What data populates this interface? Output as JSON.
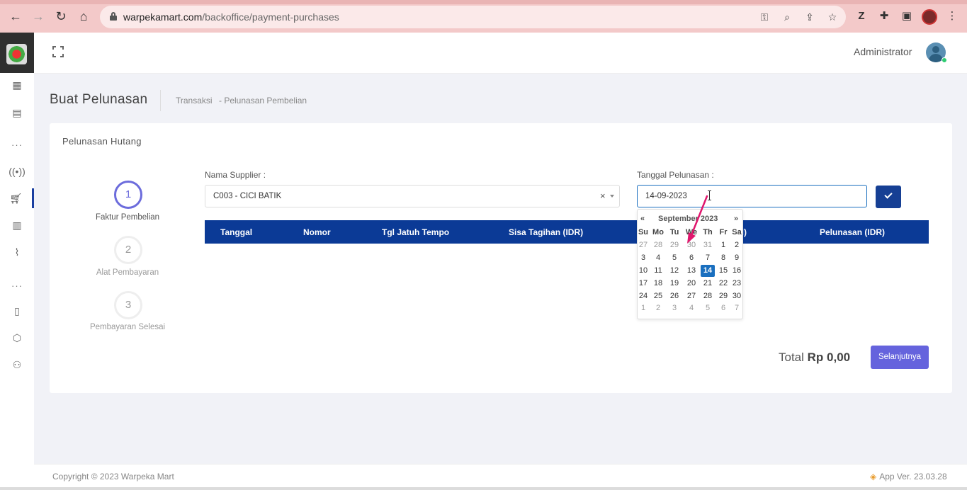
{
  "browser": {
    "url_host": "warpekamart.com",
    "url_path": "/backoffice/payment-purchases"
  },
  "header": {
    "user_name": "Administrator"
  },
  "page": {
    "title": "Buat Pelunasan",
    "breadcrumb": [
      "Transaksi",
      "- Pelunasan Pembelian"
    ]
  },
  "card": {
    "title": "Pelunasan Hutang",
    "steps": [
      {
        "number": "1",
        "label": "Faktur Pembelian",
        "active": true
      },
      {
        "number": "2",
        "label": "Alat Pembayaran",
        "active": false
      },
      {
        "number": "3",
        "label": "Pembayaran Selesai",
        "active": false
      }
    ],
    "supplier": {
      "label": "Nama Supplier :",
      "value": "C003 - CICI BATIK",
      "clear": "×"
    },
    "date": {
      "label": "Tanggal Pelunasan :",
      "value": "14-09-2023"
    },
    "table": {
      "columns": [
        "Tanggal",
        "Nomor",
        "Tgl Jatuh Tempo",
        "Sisa Tagihan (IDR)",
        "Sal)",
        "Pelunasan (IDR)"
      ]
    },
    "total": {
      "label": "Total",
      "amount": "Rp 0,00"
    },
    "next_label": "Selanjutnya"
  },
  "datepicker": {
    "prev": "«",
    "next": "»",
    "month_label": "September 2023",
    "weekdays": [
      "Su",
      "Mo",
      "Tu",
      "We",
      "Th",
      "Fr",
      "Sa"
    ],
    "weeks": [
      [
        "27",
        "28",
        "29",
        "30",
        "31",
        "1",
        "2"
      ],
      [
        "3",
        "4",
        "5",
        "6",
        "7",
        "8",
        "9"
      ],
      [
        "10",
        "11",
        "12",
        "13",
        "14",
        "15",
        "16"
      ],
      [
        "17",
        "18",
        "19",
        "20",
        "21",
        "22",
        "23"
      ],
      [
        "24",
        "25",
        "26",
        "27",
        "28",
        "29",
        "30"
      ],
      [
        "1",
        "2",
        "3",
        "4",
        "5",
        "6",
        "7"
      ]
    ],
    "selected": "14"
  },
  "footer": {
    "copyright": "Copyright © 2023 Warpeka Mart",
    "version": "App Ver. 23.03.28"
  },
  "colors": {
    "primary": "#0b3a96",
    "accent": "#6563dd",
    "annotation": "#e0166d"
  }
}
